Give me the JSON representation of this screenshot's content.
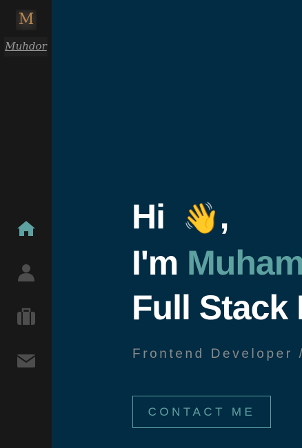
{
  "sidebar": {
    "logo_letter": "M",
    "logo_text": "Muhdor",
    "nav": [
      {
        "icon": "home-icon",
        "active": true
      },
      {
        "icon": "user-icon"
      },
      {
        "icon": "briefcase-icon"
      },
      {
        "icon": "envelope-icon"
      }
    ],
    "active_color": "#5ea1a1",
    "inactive_color": "#4d4d4d"
  },
  "hero": {
    "greeting": "Hi",
    "wave": "👋",
    "comma": ",",
    "im": "I'm",
    "name": "Muhammad",
    "role": "Full Stack Developer",
    "subtitle": "Frontend Developer / Backend Developer",
    "cta": "CONTACT ME"
  },
  "colors": {
    "background": "#022c43",
    "sidebar": "#181818",
    "accent": "#5ea1a1"
  }
}
